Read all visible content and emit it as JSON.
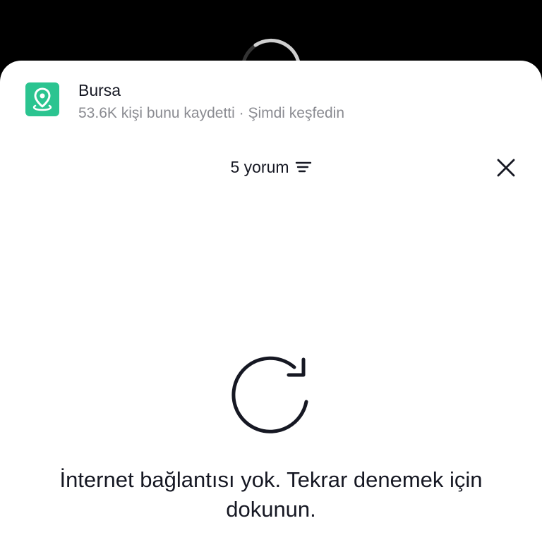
{
  "location": {
    "title": "Bursa",
    "subtitle": "53.6K kişi bunu kaydetti · Şimdi keşfedin",
    "icon": "location-pin-icon",
    "icon_color": "#2bc490"
  },
  "comments": {
    "count_label": "5 yorum",
    "filter_icon": "filter-icon",
    "close_icon": "close-icon"
  },
  "error": {
    "icon": "retry-icon",
    "message": "İnternet bağlantısı yok. Tekrar denemek için dokunun."
  },
  "colors": {
    "text_primary": "#161823",
    "text_secondary": "#8a8b91",
    "accent": "#2bc490"
  }
}
